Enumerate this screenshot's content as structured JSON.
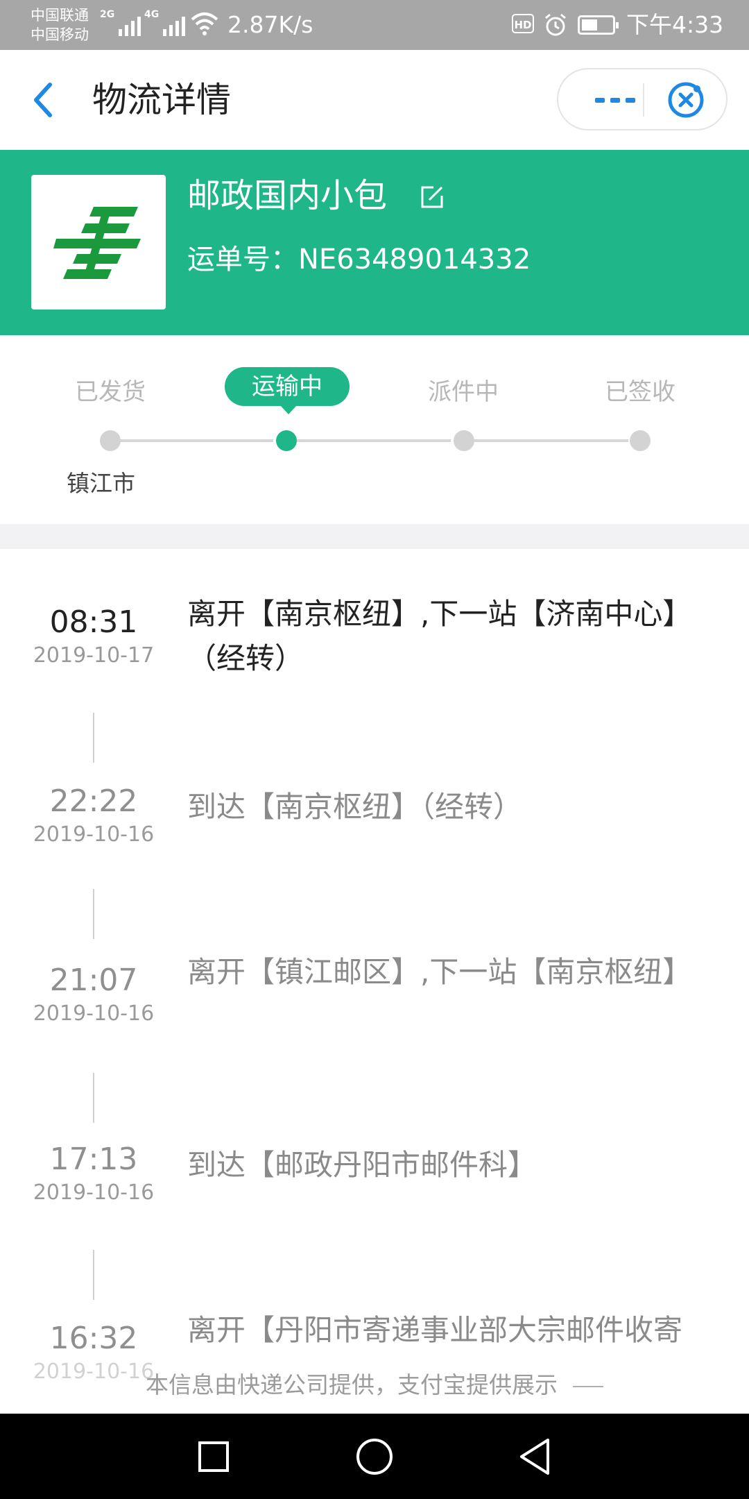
{
  "status_bar": {
    "carrier_1": "中国联通",
    "carrier_2": "中国移动",
    "net_1": "2G",
    "net_2": "4G",
    "speed": "2.87K/s",
    "hd_badge": "HD",
    "time": "下午4:33"
  },
  "nav": {
    "title": "物流详情"
  },
  "shipment": {
    "courier_name": "邮政国内小包",
    "tracking_label": "运单号：",
    "tracking_number": "NE63489014332"
  },
  "progress": {
    "steps": [
      "已发货",
      "运输中",
      "派件中",
      "已签收"
    ],
    "current_step": 1,
    "origin_city": "镇江市"
  },
  "events": [
    {
      "time": "08:31",
      "date": "2019-10-17",
      "text": "离开【南京枢纽】,下一站【济南中心】（经转）"
    },
    {
      "time": "22:22",
      "date": "2019-10-16",
      "text": "到达【南京枢纽】（经转）"
    },
    {
      "time": "21:07",
      "date": "2019-10-16",
      "text": "离开【镇江邮区】,下一站【南京枢纽】"
    },
    {
      "time": "17:13",
      "date": "2019-10-16",
      "text": "到达【邮政丹阳市邮件科】"
    },
    {
      "time": "16:32",
      "date": "2019-10-16",
      "text": "离开【丹阳市寄递事业部大宗邮件收寄"
    }
  ],
  "footer_note": "本信息由快递公司提供，支付宝提供展示",
  "colors": {
    "accent_green": "#1fb68a",
    "accent_blue": "#1e88e5"
  }
}
